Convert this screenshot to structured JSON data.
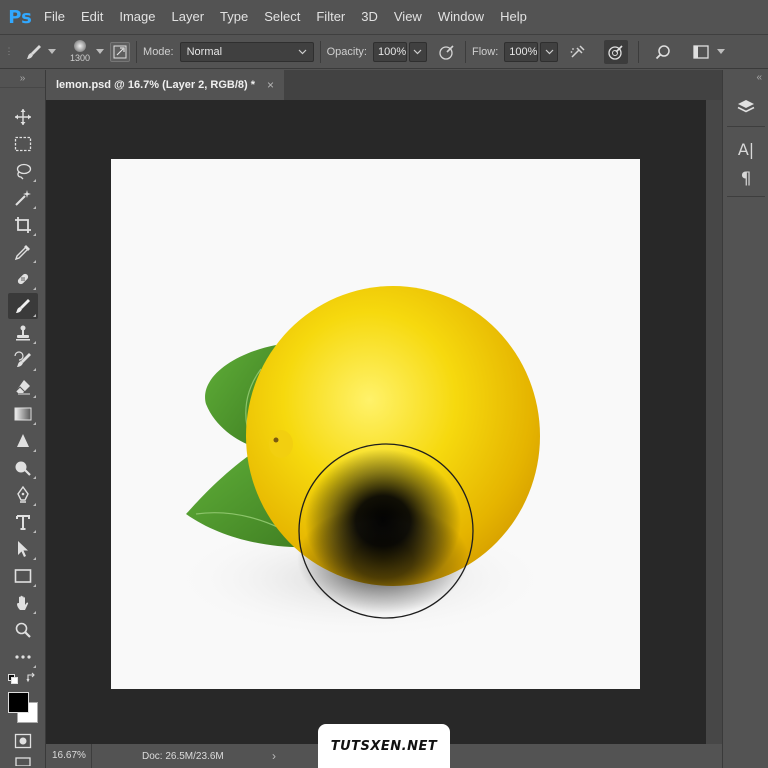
{
  "app": {
    "logo": "Ps",
    "menu": [
      "File",
      "Edit",
      "Image",
      "Layer",
      "Type",
      "Select",
      "Filter",
      "3D",
      "View",
      "Window",
      "Help"
    ]
  },
  "options_bar": {
    "brush_size": "1300",
    "mode_label": "Mode:",
    "mode_value": "Normal",
    "opacity_label": "Opacity:",
    "opacity_value": "100%",
    "flow_label": "Flow:",
    "flow_value": "100%"
  },
  "document": {
    "tab_title": "lemon.psd @ 16.7% (Layer 2, RGB/8) *",
    "close_glyph": "×"
  },
  "toolbar": {
    "tools": [
      "move-icon",
      "marquee-icon",
      "lasso-icon",
      "magic-wand-icon",
      "crop-icon",
      "eyedropper-icon",
      "healing-brush-icon",
      "brush-icon",
      "clone-stamp-icon",
      "history-brush-icon",
      "eraser-icon",
      "gradient-icon",
      "blur-icon",
      "dodge-icon",
      "pen-icon",
      "type-icon",
      "path-selection-icon",
      "rectangle-icon",
      "hand-icon",
      "zoom-icon",
      "more-tools-icon"
    ],
    "active_tool": "brush-icon",
    "foreground_color": "#000000",
    "background_color": "#ffffff"
  },
  "right_panel": {
    "buttons": [
      "layers-icon",
      "character-icon",
      "paragraph-icon"
    ],
    "character_label": "A|",
    "paragraph_label": "¶"
  },
  "status": {
    "zoom": "16.67%",
    "doc_info": "Doc: 26.5M/23.6M",
    "arrow": "›"
  },
  "watermark": "TUTSXEN.NET",
  "colors": {
    "ui_bg": "#535353",
    "workspace_bg": "#282828",
    "canvas_bg": "#f9f9f9",
    "lemon": "#f5d90f",
    "leaf": "#4f9a2f"
  }
}
